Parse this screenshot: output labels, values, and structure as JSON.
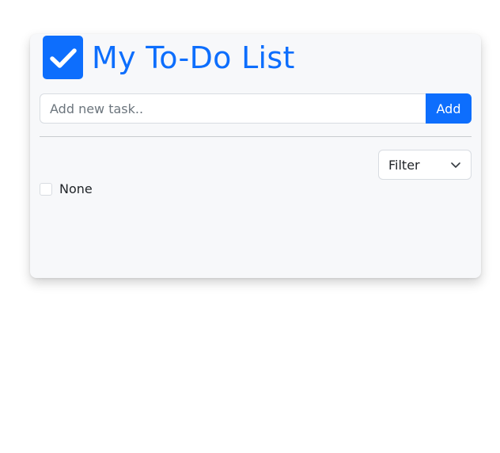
{
  "header": {
    "title": "My To-Do List",
    "icon": "checkbox-checked-icon",
    "accent_color": "#0d6efd"
  },
  "new_task": {
    "placeholder": "Add new task..",
    "value": "",
    "add_label": "Add"
  },
  "filter": {
    "selected": "Filter",
    "icon": "chevron-down-icon"
  },
  "tasks": [
    {
      "label": "None",
      "checked": false
    }
  ]
}
